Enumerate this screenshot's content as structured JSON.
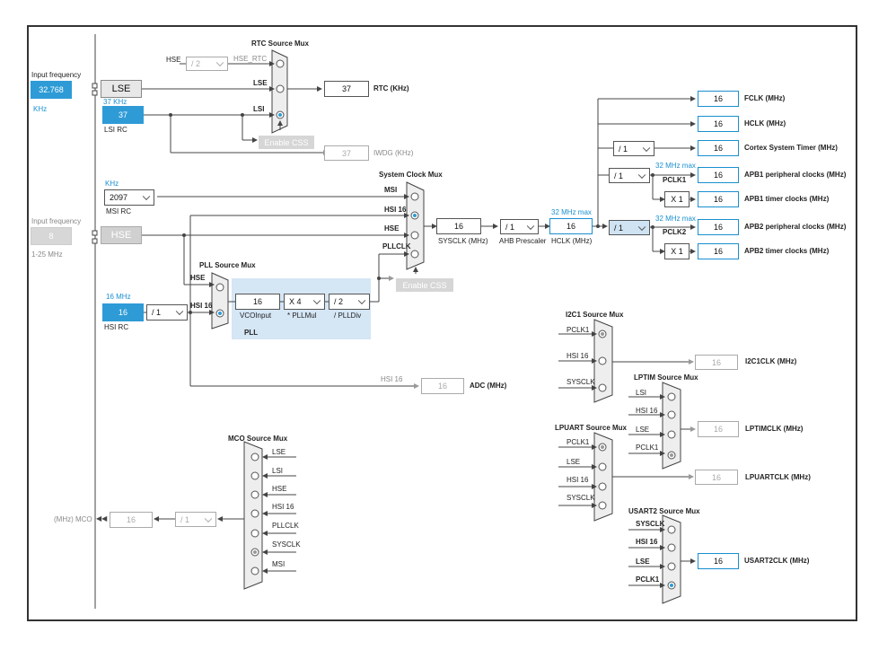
{
  "labels": {
    "rtc_mux": "RTC Source Mux",
    "sysclk_mux": "System Clock Mux",
    "pll_mux": "PLL Source Mux",
    "mco_mux": "MCO Source Mux",
    "i2c1_mux": "I2C1 Source Mux",
    "lptim_mux": "LPTIM Source Mux",
    "lpuart_mux": "LPUART Source Mux",
    "usart2_mux": "USART2 Source Mux",
    "input_frequency": "Input frequency",
    "khz": "KHz",
    "lsi_freq": "37 KHz",
    "lsi_rc": "LSI RC",
    "msi_rc": "MSI RC",
    "hse_range": "1-25 MHz",
    "hsi_freq": "16 MHz",
    "hsi_rc": "HSI RC",
    "hse": "HSE",
    "hse_rtc": "HSE_RTC",
    "lse": "LSE",
    "lsi": "LSI",
    "msi": "MSI",
    "hsi16": "HSI 16",
    "pllclk": "PLLCLK",
    "sysclk": "SYSCLK",
    "pclk1": "PCLK1",
    "pclk2": "PCLK2",
    "rtc_khz": "RTC (KHz)",
    "iwdg_khz": "IWDG (KHz)",
    "vco_input": "VCOInput",
    "pll_mul": "* PLLMul",
    "pll_div": "/ PLLDiv",
    "pll": "PLL",
    "sysclk_mhz": "SYSCLK (MHz)",
    "ahb_prescaler": "AHB Prescaler",
    "hclk_mhz": "HCLK (MHz)",
    "max32": "32 MHz max",
    "fclk": "FCLK (MHz)",
    "hclk": "HCLK (MHz)",
    "cortex_timer": "Cortex System Timer (MHz)",
    "apb1_periph": "APB1 peripheral clocks (MHz)",
    "apb1_timer": "APB1 timer clocks (MHz)",
    "apb2_periph": "APB2 peripheral clocks (MHz)",
    "apb2_timer": "APB2 timer clocks (MHz)",
    "adc": "ADC (MHz)",
    "i2c1clk": "I2C1CLK (MHz)",
    "lptimclk": "LPTIMCLK (MHz)",
    "lpuartclk": "LPUARTCLK (MHz)",
    "usart2clk": "USART2CLK (MHz)",
    "mco": "(MHz) MCO"
  },
  "inputs": {
    "lse_freq": "32.768",
    "hse_freq": "8"
  },
  "blocks": {
    "lse": "LSE",
    "hse": "HSE",
    "lsi_rc_value": "37",
    "hsi_rc_value": "16"
  },
  "selects": {
    "msi": "2097",
    "hsi_div": "/ 1",
    "hse_rtc_div": "/ 2",
    "pll_mul": "X 4",
    "pll_div": "/ 2",
    "ahb": "/ 1",
    "cortex": "/ 1",
    "apb1": "/ 1",
    "apb2": "/ 1",
    "mco_div": "/ 1"
  },
  "multipliers": {
    "apb1": "X 1",
    "apb2": "X 1"
  },
  "buttons": {
    "enable_css": "Enable CSS"
  },
  "pll": {
    "vco_input": "16"
  },
  "outputs": {
    "rtc": "37",
    "iwdg": "37",
    "sysclk": "16",
    "hclk_mid": "16",
    "fclk": "16",
    "hclk": "16",
    "cortex_timer": "16",
    "apb1_periph": "16",
    "apb1_timer": "16",
    "apb2_periph": "16",
    "apb2_timer": "16",
    "adc": "16",
    "i2c1": "16",
    "lptim": "16",
    "lpuart": "16",
    "usart2": "16",
    "mco": "16"
  },
  "icons": {
    "mco_arrow": "◀◀"
  },
  "colors": {
    "accent_blue": "#2e9bd6",
    "pll_area": "#d5e6f5",
    "disabled_gray": "#d6d6d6"
  }
}
